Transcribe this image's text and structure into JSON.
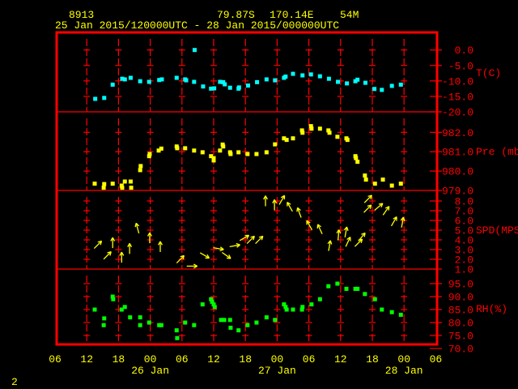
{
  "header": {
    "station_id": "8913",
    "latitude": "79.87S",
    "longitude": "170.14E",
    "elevation": "54M",
    "time_range": "25 Jan 2015/120000UTC - 28 Jan 2015/000000UTC"
  },
  "page_number": "2",
  "colors": {
    "frame": "#ff0000",
    "text": "#ffff00",
    "temperature": "#00ffff",
    "pressure": "#ffff00",
    "wind": "#ffff00",
    "humidity": "#00ff00"
  },
  "chart_data": {
    "type": "scatter",
    "x_unit": "hours since 25 Jan 2015 06 UTC",
    "xlim": [
      0,
      72
    ],
    "x_ticks": [
      {
        "h": 0,
        "label": "06"
      },
      {
        "h": 6,
        "label": "12"
      },
      {
        "h": 12,
        "label": "18"
      },
      {
        "h": 18,
        "label": "00"
      },
      {
        "h": 24,
        "label": "06"
      },
      {
        "h": 30,
        "label": "12"
      },
      {
        "h": 36,
        "label": "18"
      },
      {
        "h": 42,
        "label": "00"
      },
      {
        "h": 48,
        "label": "06"
      },
      {
        "h": 54,
        "label": "12"
      },
      {
        "h": 60,
        "label": "18"
      },
      {
        "h": 66,
        "label": "00"
      },
      {
        "h": 72,
        "label": "06"
      }
    ],
    "date_labels": [
      {
        "h": 18,
        "label": "26 Jan"
      },
      {
        "h": 42,
        "label": "27 Jan"
      },
      {
        "h": 66,
        "label": "28 Jan"
      }
    ],
    "grid": true,
    "panels": [
      {
        "id": "temperature",
        "ylabel": "T(C)",
        "ylim": [
          -20,
          0
        ],
        "ticks": [
          0,
          -5,
          -10,
          -15,
          -20
        ],
        "tick_labels": [
          "0.0",
          "-5.0",
          "-10.0",
          "-15.0",
          "-20.0"
        ],
        "points": [
          [
            7.6,
            -15.8
          ],
          [
            9.3,
            -15.5
          ],
          [
            10.9,
            -11.2
          ],
          [
            12.7,
            -9.3
          ],
          [
            13.2,
            -9.5
          ],
          [
            14.3,
            -9.0
          ],
          [
            16.1,
            -10.1
          ],
          [
            17.8,
            -10.3
          ],
          [
            19.7,
            -9.7
          ],
          [
            20.2,
            -9.5
          ],
          [
            23.0,
            -9.0
          ],
          [
            24.6,
            -9.5
          ],
          [
            24.8,
            -9.8
          ],
          [
            26.4,
            0.0
          ],
          [
            26.3,
            -10.3
          ],
          [
            28.0,
            -11.8
          ],
          [
            29.5,
            -12.5
          ],
          [
            30.1,
            -12.4
          ],
          [
            31.2,
            -10.3
          ],
          [
            31.8,
            -10.4
          ],
          [
            32.1,
            -11.1
          ],
          [
            33.1,
            -12.2
          ],
          [
            34.7,
            -12.5
          ],
          [
            34.8,
            -12.1
          ],
          [
            36.5,
            -11.5
          ],
          [
            38.2,
            -10.4
          ],
          [
            40.0,
            -9.5
          ],
          [
            41.6,
            -9.8
          ],
          [
            43.3,
            -9.0
          ],
          [
            43.6,
            -8.6
          ],
          [
            45.0,
            -7.7
          ],
          [
            46.8,
            -8.2
          ],
          [
            48.4,
            -7.9
          ],
          [
            50.1,
            -8.5
          ],
          [
            51.8,
            -9.3
          ],
          [
            53.5,
            -10.3
          ],
          [
            55.2,
            -10.8
          ],
          [
            56.8,
            -10.1
          ],
          [
            57.2,
            -9.6
          ],
          [
            58.7,
            -10.6
          ],
          [
            60.4,
            -12.6
          ],
          [
            61.8,
            -12.9
          ],
          [
            63.7,
            -11.6
          ],
          [
            65.4,
            -11.2
          ]
        ]
      },
      {
        "id": "pressure",
        "ylabel": "Pre (mb)",
        "ylim": [
          979,
          982
        ],
        "ticks": [
          982,
          981,
          980,
          979
        ],
        "tick_labels": [
          "982.0",
          "981.0",
          "980.0",
          "979.0"
        ],
        "points": [
          [
            7.5,
            979.35
          ],
          [
            9.3,
            979.33
          ],
          [
            9.2,
            979.14
          ],
          [
            10.9,
            979.35
          ],
          [
            12.6,
            979.25
          ],
          [
            12.7,
            979.14
          ],
          [
            13.2,
            979.46
          ],
          [
            14.3,
            979.46
          ],
          [
            14.4,
            979.14
          ],
          [
            16.1,
            980.05
          ],
          [
            16.2,
            980.26
          ],
          [
            17.8,
            980.77
          ],
          [
            17.9,
            980.88
          ],
          [
            19.6,
            981.06
          ],
          [
            20.1,
            981.16
          ],
          [
            23.0,
            981.27
          ],
          [
            23.1,
            981.18
          ],
          [
            24.6,
            981.18
          ],
          [
            26.3,
            981.06
          ],
          [
            27.9,
            980.97
          ],
          [
            29.5,
            980.77
          ],
          [
            30.0,
            980.67
          ],
          [
            30.0,
            980.55
          ],
          [
            31.2,
            981.06
          ],
          [
            31.7,
            981.37
          ],
          [
            31.8,
            981.27
          ],
          [
            33.1,
            980.97
          ],
          [
            33.2,
            980.88
          ],
          [
            34.7,
            980.97
          ],
          [
            36.4,
            980.88
          ],
          [
            38.1,
            980.88
          ],
          [
            40.0,
            980.97
          ],
          [
            41.6,
            981.38
          ],
          [
            43.3,
            981.69
          ],
          [
            43.8,
            981.61
          ],
          [
            45.0,
            981.69
          ],
          [
            46.7,
            982.1
          ],
          [
            46.8,
            981.98
          ],
          [
            48.4,
            982.32
          ],
          [
            48.5,
            982.19
          ],
          [
            50.1,
            982.19
          ],
          [
            51.7,
            982.1
          ],
          [
            51.9,
            981.98
          ],
          [
            53.4,
            981.77
          ],
          [
            55.1,
            981.69
          ],
          [
            55.3,
            981.61
          ],
          [
            56.8,
            980.77
          ],
          [
            56.9,
            980.67
          ],
          [
            57.2,
            980.48
          ],
          [
            58.6,
            979.77
          ],
          [
            58.8,
            979.56
          ],
          [
            60.5,
            979.35
          ],
          [
            62.0,
            979.56
          ],
          [
            63.7,
            979.25
          ],
          [
            65.4,
            979.35
          ]
        ]
      },
      {
        "id": "wind",
        "ylabel": "SPD(MPS)",
        "ylim": [
          1,
          8
        ],
        "ticks": [
          8,
          7,
          6,
          5,
          4,
          3,
          2,
          1
        ],
        "tick_labels": [
          "8.0",
          "7.0",
          "6.0",
          "5.0",
          "4.0",
          "3.0",
          "2.0",
          "1.0"
        ],
        "point_format": "[hour, speed_mps, arrow_bearing_deg]",
        "points": [
          [
            8.1,
            3.5,
            45
          ],
          [
            9.9,
            2.4,
            45
          ],
          [
            10.9,
            3.7,
            0
          ],
          [
            12.6,
            2.2,
            0
          ],
          [
            14.1,
            3.1,
            0
          ],
          [
            15.6,
            5.2,
            345
          ],
          [
            17.9,
            4.2,
            0
          ],
          [
            19.9,
            3.3,
            0
          ],
          [
            23.7,
            2.0,
            45
          ],
          [
            25.9,
            1.3,
            90
          ],
          [
            28.3,
            2.4,
            120
          ],
          [
            30.9,
            3.1,
            100
          ],
          [
            32.4,
            2.4,
            125
          ],
          [
            34.0,
            3.4,
            80
          ],
          [
            35.8,
            4.2,
            60
          ],
          [
            37.0,
            4.0,
            45
          ],
          [
            38.6,
            4.0,
            45
          ],
          [
            39.8,
            8.0,
            0
          ],
          [
            41.5,
            7.6,
            0
          ],
          [
            42.9,
            8.1,
            30
          ],
          [
            44.4,
            7.4,
            330
          ],
          [
            46.2,
            6.8,
            340
          ],
          [
            48.1,
            5.5,
            330
          ],
          [
            50.1,
            5.1,
            335
          ],
          [
            51.9,
            3.4,
            10
          ],
          [
            53.6,
            4.5,
            5
          ],
          [
            55.0,
            4.8,
            10
          ],
          [
            55.4,
            3.8,
            25
          ],
          [
            57.4,
            3.7,
            45
          ],
          [
            58.0,
            4.3,
            40
          ],
          [
            59.2,
            8.2,
            45
          ],
          [
            59.1,
            7.2,
            45
          ],
          [
            61.2,
            7.4,
            50
          ],
          [
            62.6,
            7.0,
            35
          ],
          [
            64.1,
            5.9,
            30
          ],
          [
            65.7,
            5.8,
            10
          ]
        ]
      },
      {
        "id": "humidity",
        "ylabel": "RH(%)",
        "ylim": [
          70,
          95
        ],
        "ticks": [
          95,
          90,
          85,
          80,
          75,
          70
        ],
        "tick_labels": [
          "95.0",
          "90.0",
          "85.0",
          "80.0",
          "75.0",
          "70.0"
        ],
        "points": [
          [
            7.5,
            85
          ],
          [
            9.3,
            81.6
          ],
          [
            9.2,
            79
          ],
          [
            10.9,
            90
          ],
          [
            11.0,
            89
          ],
          [
            12.6,
            85
          ],
          [
            13.2,
            86
          ],
          [
            14.2,
            82
          ],
          [
            16.1,
            82
          ],
          [
            16.1,
            79
          ],
          [
            17.8,
            80
          ],
          [
            19.7,
            79
          ],
          [
            20.1,
            79
          ],
          [
            23.0,
            77
          ],
          [
            23.1,
            74
          ],
          [
            24.6,
            80
          ],
          [
            26.3,
            79
          ],
          [
            27.9,
            87
          ],
          [
            29.5,
            89
          ],
          [
            29.7,
            88
          ],
          [
            30.0,
            87
          ],
          [
            30.2,
            86
          ],
          [
            31.4,
            81
          ],
          [
            32.0,
            81
          ],
          [
            33.1,
            81
          ],
          [
            33.2,
            78
          ],
          [
            34.7,
            77
          ],
          [
            36.4,
            79
          ],
          [
            38.1,
            80
          ],
          [
            40.0,
            82
          ],
          [
            41.6,
            81
          ],
          [
            43.3,
            87
          ],
          [
            43.6,
            86
          ],
          [
            43.8,
            85
          ],
          [
            45.0,
            85
          ],
          [
            46.7,
            85
          ],
          [
            46.8,
            86
          ],
          [
            48.5,
            87
          ],
          [
            50.1,
            89
          ],
          [
            51.7,
            94
          ],
          [
            53.4,
            95
          ],
          [
            55.1,
            93
          ],
          [
            56.8,
            93
          ],
          [
            57.2,
            93
          ],
          [
            58.6,
            91
          ],
          [
            60.5,
            89
          ],
          [
            61.8,
            85
          ],
          [
            63.7,
            84
          ],
          [
            65.4,
            83
          ]
        ]
      }
    ]
  }
}
